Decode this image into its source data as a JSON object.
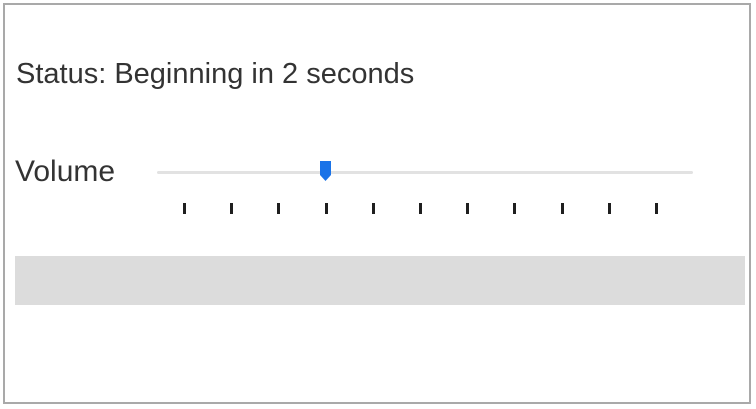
{
  "status": {
    "text": "Status: Beginning in 2 seconds"
  },
  "volume": {
    "label": "Volume",
    "value_fraction": 0.3125,
    "tick_count": 11,
    "accent_color": "#1a73e8",
    "track_color": "#e2e2e2"
  },
  "bar": {
    "color": "#dcdcdc"
  }
}
